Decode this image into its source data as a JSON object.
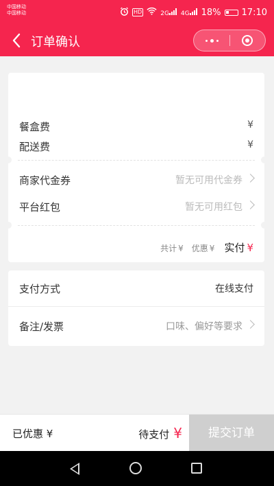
{
  "status_bar": {
    "carrier_1": "中国移动",
    "carrier_2": "中国移动",
    "icons": [
      "alarm-icon",
      "hd-icon",
      "wifi-icon",
      "signal-icon",
      "signal-icon",
      "battery-icon"
    ],
    "hd_label": "HD",
    "signal_1_label": "2G",
    "signal_2_label": "4G",
    "battery": "18%",
    "time": "17:10"
  },
  "nav_bar": {
    "back_icon": "chevron-left-icon",
    "title": "订单确认",
    "more_icon": "more-dots-icon",
    "close_icon": "target-close-icon"
  },
  "fees": {
    "box_fee_label": "餐盒费",
    "box_fee_value": "¥",
    "delivery_fee_label": "配送费",
    "delivery_fee_value": "¥"
  },
  "coupons": {
    "merchant_coupon_label": "商家代金券",
    "merchant_coupon_hint": "暂无可用代金券",
    "platform_red_packet_label": "平台红包",
    "platform_red_packet_hint": "暂无可用红包"
  },
  "summary": {
    "total_label": "共计",
    "total_value": "¥",
    "discount_label": "优惠",
    "discount_value": "¥",
    "paid_label": "实付",
    "paid_value": "¥"
  },
  "payment": {
    "method_label": "支付方式",
    "method_value": "在线支付"
  },
  "remark": {
    "label": "备注/发票",
    "hint": "口味、偏好等要求"
  },
  "bottom_bar": {
    "discount_label": "已优惠 ¥",
    "to_pay_label": "待支付",
    "to_pay_value": "¥",
    "submit_label": "提交订单"
  },
  "colors": {
    "brand": "#f5254e",
    "background": "#f2f2f2",
    "disabled_button": "#cfcfcf",
    "hint_text": "#bbbbbb"
  }
}
